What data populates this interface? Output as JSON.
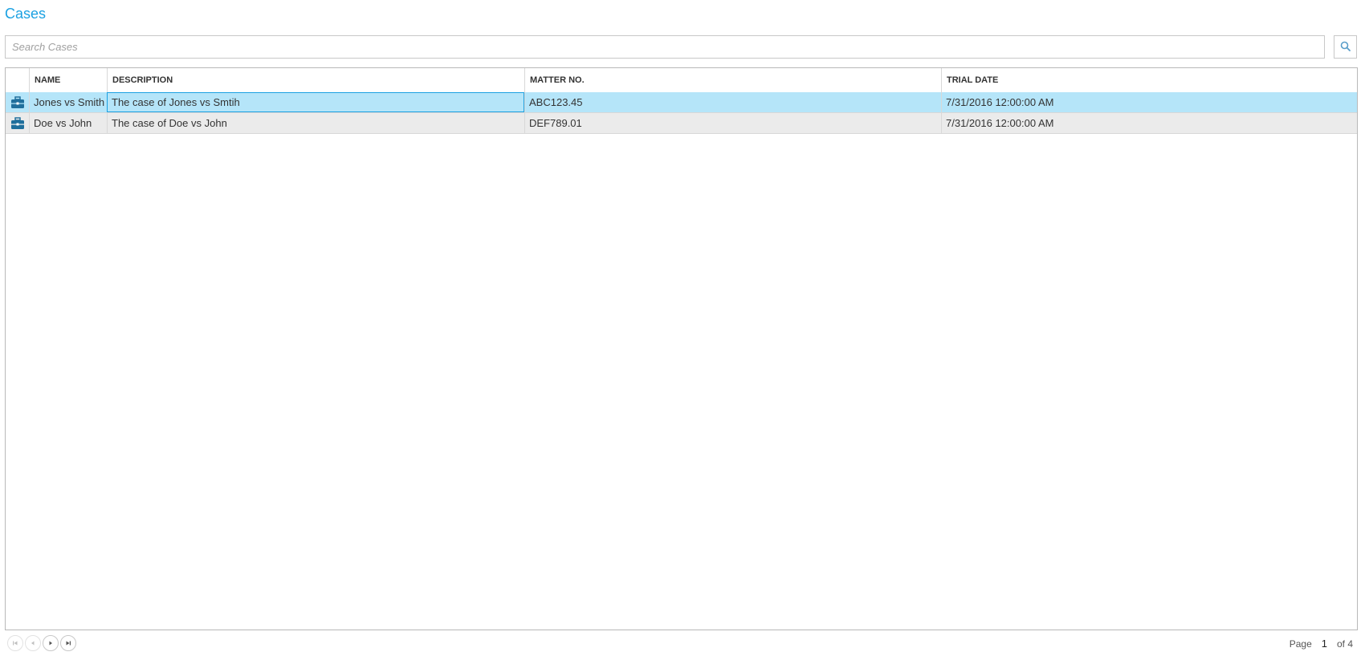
{
  "page": {
    "title": "Cases"
  },
  "search": {
    "placeholder": "Search Cases",
    "value": "",
    "icon": "search-icon"
  },
  "grid": {
    "columns": [
      "",
      "NAME",
      "DESCRIPTION",
      "MATTER NO.",
      "TRIAL DATE"
    ],
    "rows": [
      {
        "icon": "briefcase-icon",
        "name": "Jones vs Smith",
        "description": "The case of Jones vs Smtih",
        "matter_no": "ABC123.45",
        "trial_date": "7/31/2016 12:00:00 AM",
        "selected": true
      },
      {
        "icon": "briefcase-icon",
        "name": "Doe vs John",
        "description": "The case of Doe vs John",
        "matter_no": "DEF789.01",
        "trial_date": "7/31/2016 12:00:00 AM",
        "selected": false
      }
    ]
  },
  "pager": {
    "page_label": "Page",
    "current_page": "1",
    "of_label": "of 4",
    "buttons": [
      "first-page-icon",
      "prev-page-icon",
      "next-page-icon",
      "last-page-icon"
    ]
  },
  "colors": {
    "accent": "#1ba1e2",
    "selected_row": "#b5e5f9",
    "alt_row": "#ebebeb",
    "icon": "#1f6f9c"
  }
}
